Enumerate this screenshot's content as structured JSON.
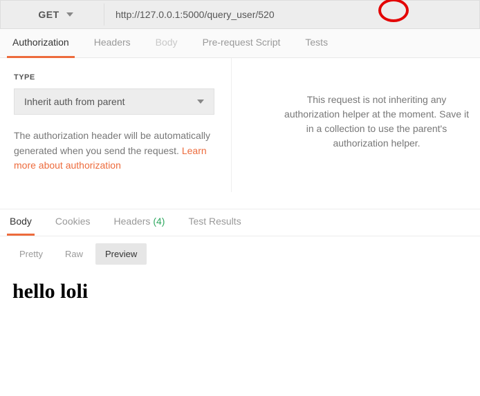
{
  "request": {
    "method": "GET",
    "url": "http://127.0.0.1:5000/query_user/520"
  },
  "tabs": {
    "authorization": "Authorization",
    "headers": "Headers",
    "body": "Body",
    "prerequest": "Pre-request Script",
    "tests": "Tests"
  },
  "auth": {
    "type_label": "TYPE",
    "dropdown_value": "Inherit auth from parent",
    "description_prefix": "The authorization header will be automatically generated when you send the request. ",
    "learn_more": "Learn more about authorization",
    "right_message": "This request is not inheriting any authorization helper at the moment. Save it in a collection to use the parent's authorization helper."
  },
  "response_tabs": {
    "body": "Body",
    "cookies": "Cookies",
    "headers": "Headers",
    "headers_count": "(4)",
    "test_results": "Test Results"
  },
  "view_tabs": {
    "pretty": "Pretty",
    "raw": "Raw",
    "preview": "Preview"
  },
  "preview_content": "hello loli"
}
